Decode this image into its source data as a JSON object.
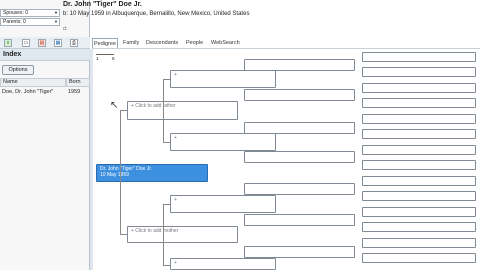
{
  "header": {
    "title": "Dr. John \"Tiger\" Doe Jr.",
    "birth": "b: 10 May 1959 in Albuquerque, Bernalillo, New Mexico, United States",
    "spouses_label": "Spouses: 0",
    "parents_label": "Parents: 0",
    "death_flag": "d:"
  },
  "toolbar": {
    "icons": [
      "excel-icon",
      "file-icon",
      "pdf-icon",
      "chart-icon",
      "print-icon"
    ]
  },
  "index": {
    "heading": "Index",
    "options_label": "Options",
    "columns": [
      "Name",
      "Born"
    ],
    "rows": [
      {
        "name": "Doe, Dr. John \"Tiger\"",
        "born": "1959"
      }
    ]
  },
  "tabs": [
    "Pedigree",
    "Family",
    "Descendants",
    "People",
    "WebSearch"
  ],
  "active_tab": "Pedigree",
  "generation_indicator": {
    "left": "1",
    "right": "5"
  },
  "pedigree": {
    "root_name": "Dr. John \"Tiger\" Doe Jr.",
    "root_born": "10 May 1959",
    "add_father": "+ Click to add father",
    "add_mother": "+ Click to add mother",
    "colors": {
      "selected": "#3d8fe0",
      "border": "#7f8a95"
    }
  }
}
